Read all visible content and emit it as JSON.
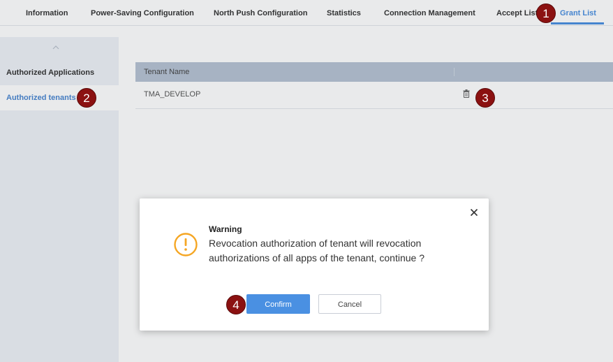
{
  "tabs": [
    {
      "label": "Information"
    },
    {
      "label": "Power-Saving Configuration"
    },
    {
      "label": "North Push Configuration"
    },
    {
      "label": "Statistics"
    },
    {
      "label": "Connection Management"
    },
    {
      "label": "Accept List"
    },
    {
      "label": "Grant List",
      "active": true
    }
  ],
  "sidebar": {
    "items": [
      {
        "label": "Authorized Applications"
      },
      {
        "label": "Authorized tenants",
        "selected": true
      }
    ]
  },
  "table": {
    "columns": [
      "Tenant Name",
      ""
    ],
    "rows": [
      {
        "tenant_name": "TMA_DEVELOP",
        "action_icon": "trash-icon"
      }
    ]
  },
  "dialog": {
    "icon": "warning-icon",
    "title": "Warning",
    "message": "Revocation authorization of tenant will revocation authorizations of all apps of the tenant, continue ?",
    "confirm_label": "Confirm",
    "cancel_label": "Cancel"
  },
  "badges": [
    "1",
    "2",
    "3",
    "4"
  ],
  "colors": {
    "accent": "#4a90e2",
    "warning": "#f5a623",
    "badge": "#8b1111",
    "table_header": "#b6c2d3",
    "sidebar_bg": "#eef1f6"
  }
}
